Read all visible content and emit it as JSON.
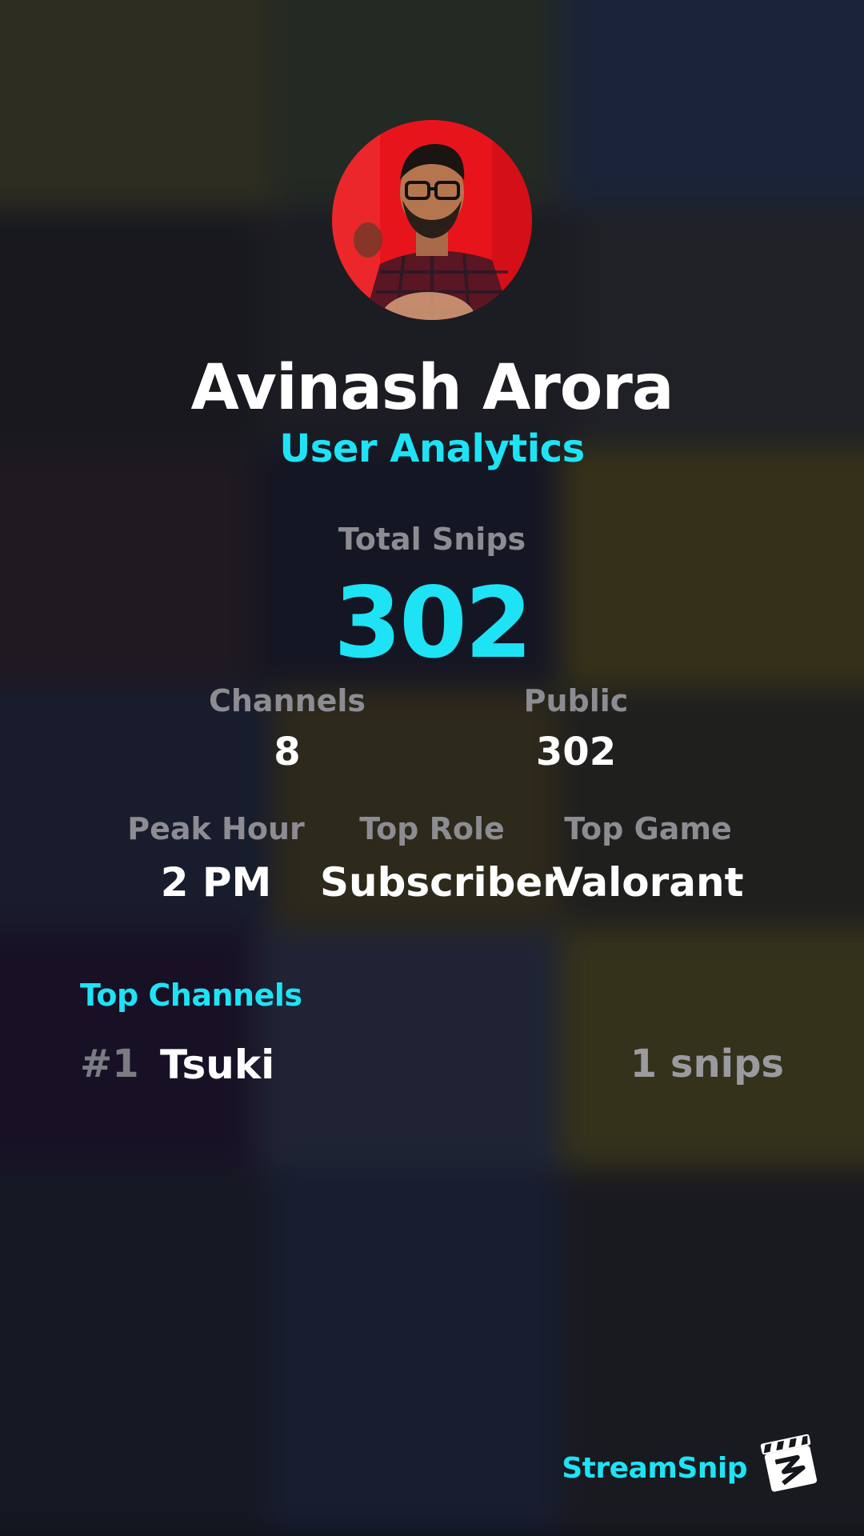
{
  "profile": {
    "name": "Avinash Arora",
    "subtitle": "User Analytics"
  },
  "stats": {
    "total_label": "Total Snips",
    "total_value": "302",
    "channels_label": "Channels",
    "channels_value": "8",
    "public_label": "Public",
    "public_value": "302",
    "peak_hour_label": "Peak Hour",
    "peak_hour_value": "2 PM",
    "top_role_label": "Top Role",
    "top_role_value": "Subscriber",
    "top_game_label": "Top Game",
    "top_game_value": "Valorant"
  },
  "top_channels": {
    "title": "Top Channels",
    "items": [
      {
        "rank": "#1",
        "name": "Tsuki",
        "count": "1 snips"
      }
    ]
  },
  "branding": {
    "name": "StreamSnip"
  },
  "colors": {
    "accent": "#1ee3f5",
    "label": "#8c8c92",
    "value": "#ffffff",
    "avatar_bg": "#e8141c"
  },
  "icons": {
    "avatar": "user-photo",
    "logo": "clapperboard-icon"
  }
}
